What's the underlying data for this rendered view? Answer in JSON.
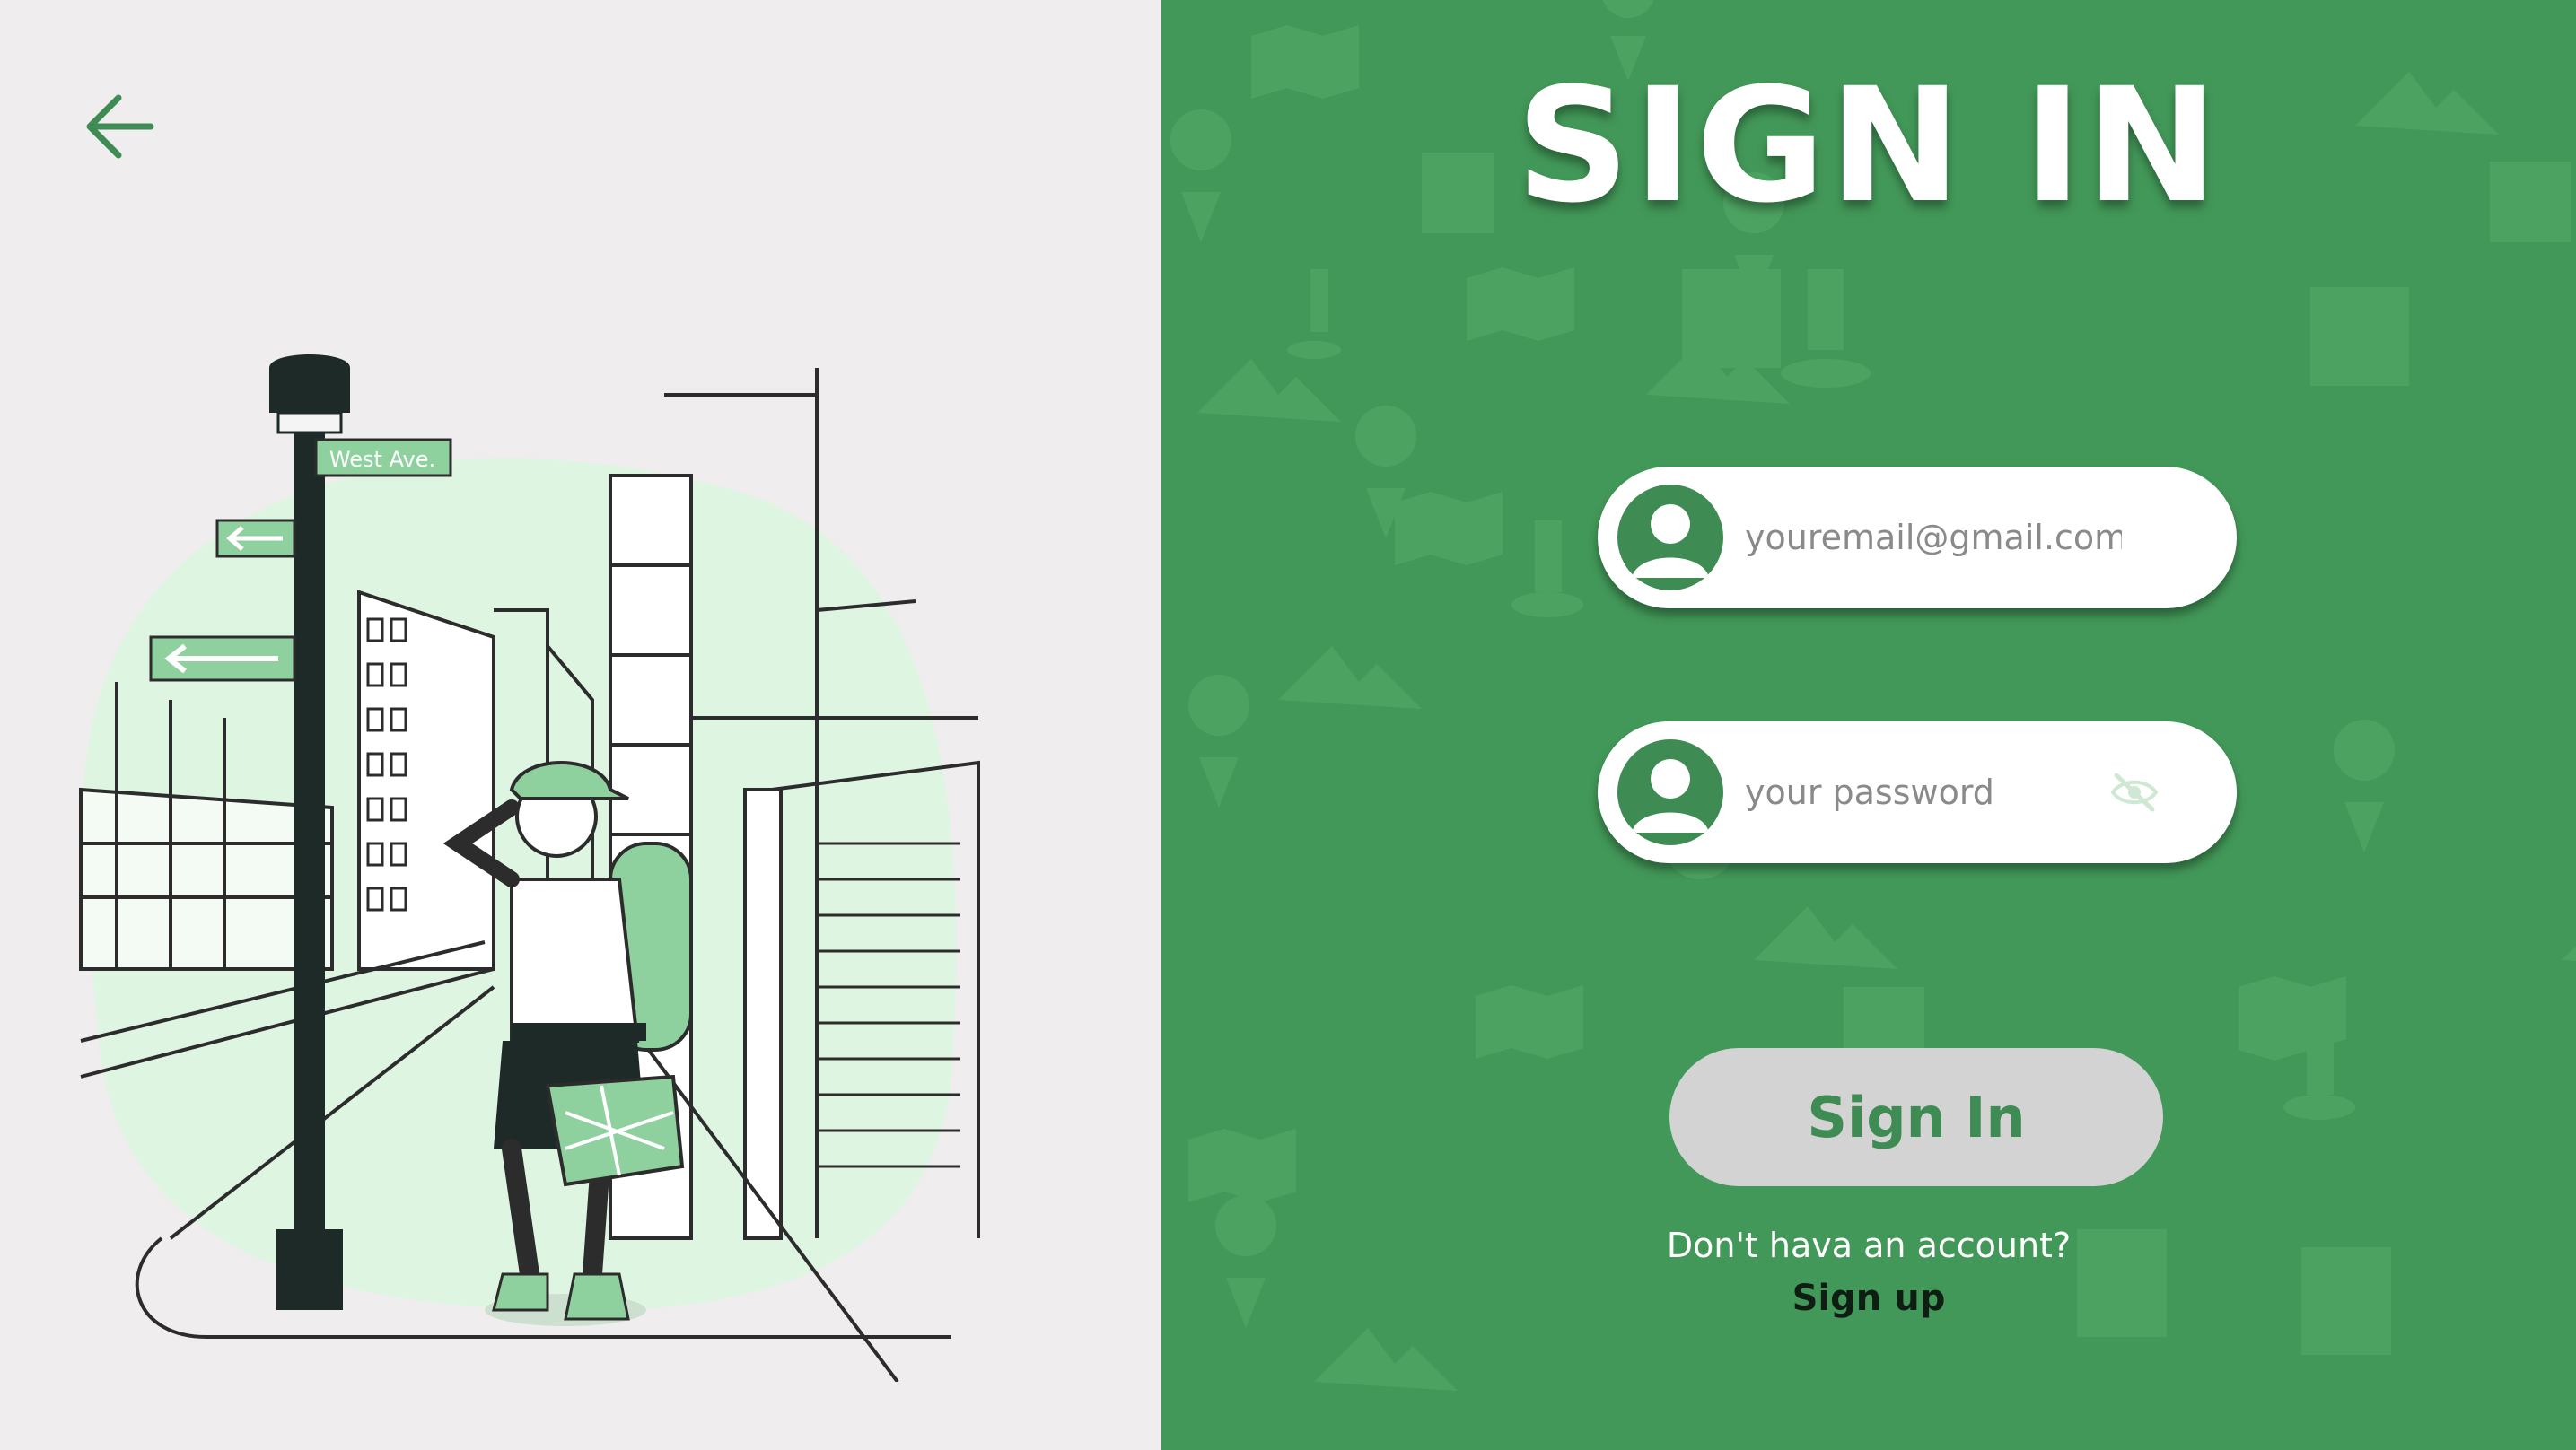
{
  "nav": {
    "back_icon": "arrow-left-icon"
  },
  "illustration": {
    "street_sign_text": "West Ave.",
    "accent_color": "#8fd19e",
    "light_color": "#def5e2"
  },
  "signin": {
    "title": "SIGN IN",
    "email_placeholder": "youremail@gmail.com",
    "email_icon": "user-avatar-icon",
    "password_placeholder": "your password",
    "password_icon": "user-avatar-icon",
    "password_toggle_icon": "eye-slash-icon",
    "submit_label": "Sign In",
    "no_account_text": "Don't hava an account?",
    "signup_label": "Sign up"
  },
  "colors": {
    "brand_green": "#429858",
    "dark_green": "#3e8c54",
    "left_background": "#efedee",
    "button_gray": "#d3d3d3"
  }
}
